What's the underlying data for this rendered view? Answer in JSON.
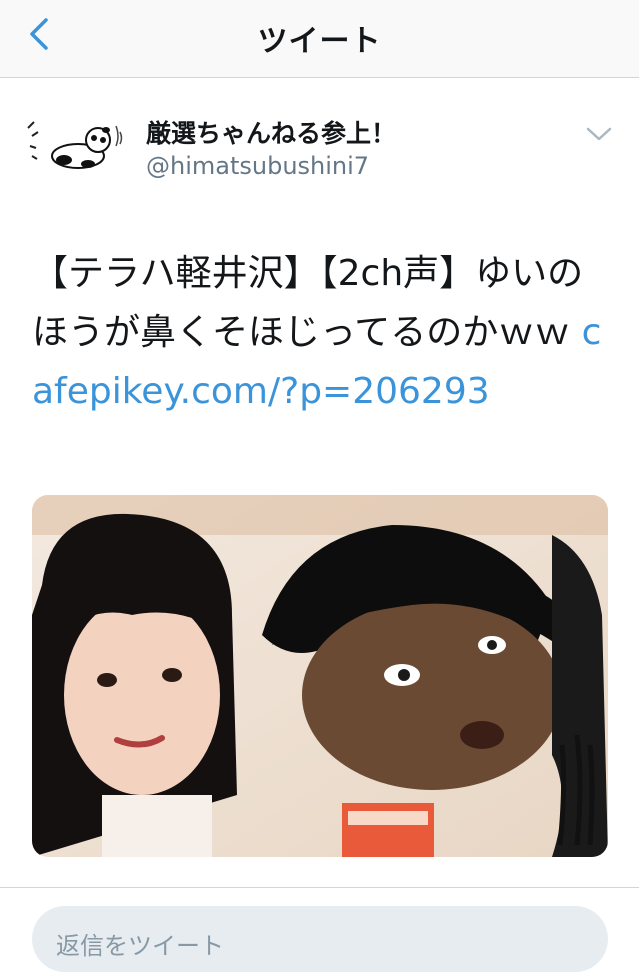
{
  "nav": {
    "title": "ツイート"
  },
  "author": {
    "display_name": "厳選ちゃんねる参上！",
    "handle": "@himatsubushini7"
  },
  "tweet": {
    "text": "【テラハ軽井沢】【2ch声】ゆいのほうが鼻くそほじってるのかｗｗ",
    "link": "cafepikey.com/?p=206293"
  },
  "reply": {
    "placeholder": "返信をツイート"
  },
  "colors": {
    "accent": "#3b94d9",
    "text": "#14171a",
    "secondary": "#657786",
    "reply_bg": "#e6ecf0"
  },
  "icons": {
    "back": "chevron-left-icon",
    "more": "chevron-down-icon"
  }
}
